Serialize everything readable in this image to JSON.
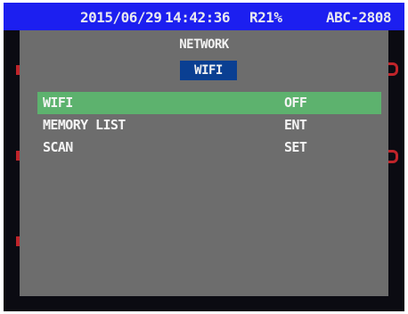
{
  "status_bar": {
    "date": "2015/06/29",
    "time": "14:42:36",
    "record": "R21%",
    "camera_id": "ABC-2808"
  },
  "menu": {
    "title": "NETWORK",
    "subtitle": "WIFI",
    "items": [
      {
        "label": "WIFI",
        "value": "OFF",
        "selected": true
      },
      {
        "label": "MEMORY LIST",
        "value": "ENT",
        "selected": false
      },
      {
        "label": "SCAN",
        "value": "SET",
        "selected": false
      }
    ]
  },
  "colors": {
    "status_bar_bg": "#1c1ff0",
    "panel_bg": "#6d6d6d",
    "selected_row": "#5db26e",
    "subtitle_bg": "#0a3f92",
    "screen_bg": "#0b0b12",
    "marker": "#c0242a"
  }
}
